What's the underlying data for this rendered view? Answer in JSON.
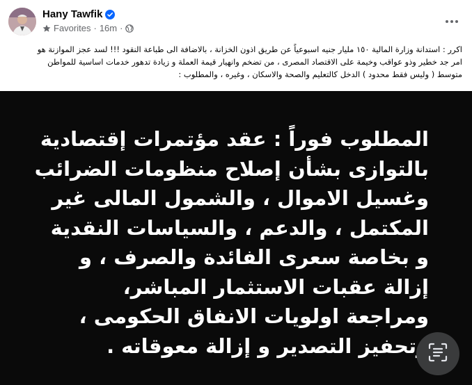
{
  "post": {
    "author": "Hany Tawfik",
    "audience": "Favorites",
    "separator": "·",
    "time": "16m",
    "body_lines": [
      "اكرر : استدانة وزارة المالية ١٥٠ مليار جنيه اسبوعياً عن طريق اذون الخزانة ، بالاضافة الى طباعة النقود !!! لسد عجز الموازنة هو",
      "امر جد خطير وذو عواقب وخيمة على الاقتصاد المصرى ، من تضخم وانهيار قيمة العملة و زيادة تدهور خدمات اساسية للمواطن",
      "متوسط ( وليس فقط محدود ) الدخل كالتعليم والصحة والاسكان ، وغيره ، والمطلوب :"
    ]
  },
  "image": {
    "lines": [
      "المطلوب فوراً : عقد مؤتمرات إقتصادية",
      "بالتوازى بشأن إصلاح منظومات الضرائب",
      "وغسيل الاموال ، والشمول المالى غير",
      "المكتمل ، والدعم ، والسياسات النقدية",
      "و بخاصة سعرى الفائدة والصرف ،  و",
      "إزالة عقبات  الاستثمار المباشر،",
      "ومراجعة اولويات الانفاق الحكومى ،",
      "وتحفيز التصدير و إزالة معوقاته ."
    ]
  },
  "icons": {
    "verified": "verified-badge-icon",
    "favorites": "star-icon",
    "audience": "globe-icon",
    "more": "more-options-icon",
    "scan": "text-scan-icon"
  },
  "colors": {
    "verified": "#0866ff",
    "meta": "#65676b",
    "image_bg": "#0a0a0a",
    "image_text": "#ffffff"
  }
}
